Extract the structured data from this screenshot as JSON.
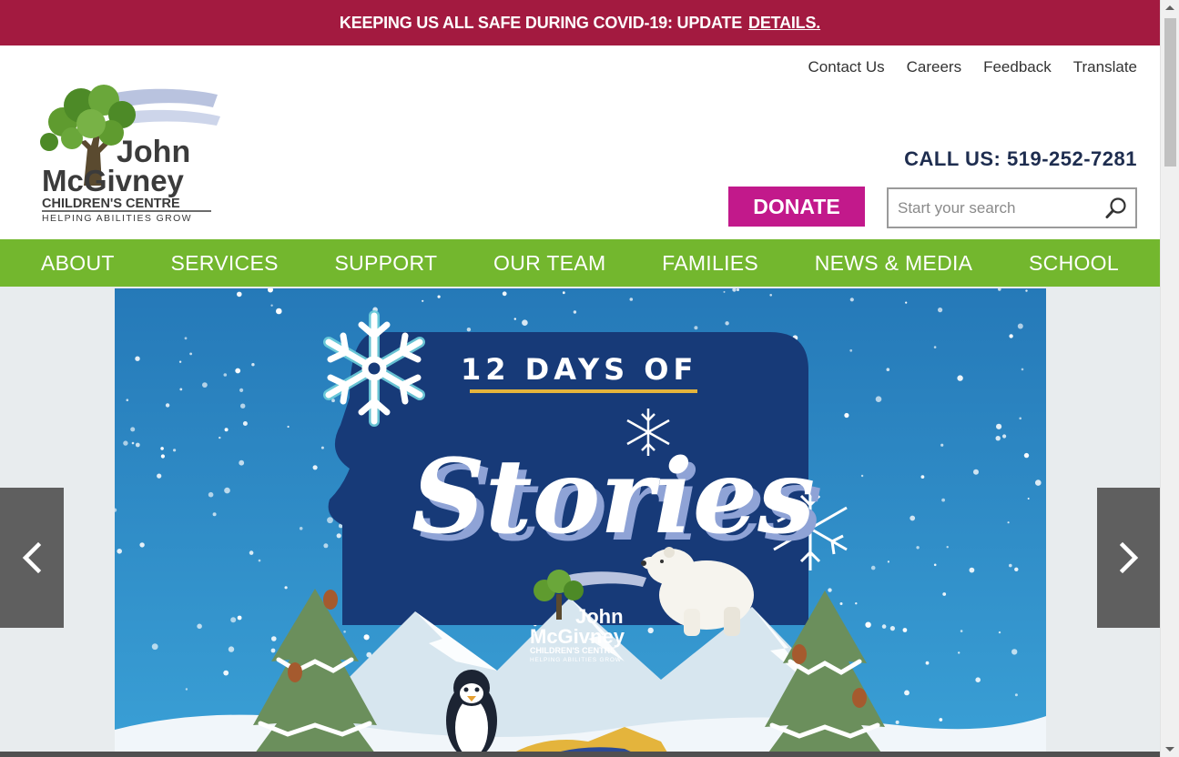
{
  "alert": {
    "text": "KEEPING US ALL SAFE DURING COVID-19: UPDATE",
    "link": "DETAILS."
  },
  "utility_nav": [
    "Contact Us",
    "Careers",
    "Feedback",
    "Translate"
  ],
  "logo": {
    "line1": "John",
    "line2": "McGivney",
    "line3": "CHILDREN'S CENTRE",
    "tagline": "HELPING ABILITIES GROW"
  },
  "call_us": "CALL US: 519-252-7281",
  "donate_label": "DONATE",
  "search": {
    "placeholder": "Start your search"
  },
  "main_nav": [
    "ABOUT",
    "SERVICES",
    "SUPPORT",
    "OUR TEAM",
    "FAMILIES",
    "NEWS & MEDIA",
    "SCHOOL"
  ],
  "banner": {
    "title_top": "12 DAYS OF",
    "title_main": "Stories",
    "logo_line1": "John",
    "logo_line2": "McGivney",
    "logo_line3": "CHILDREN'S CENTRE",
    "logo_tagline": "HELPING ABILITIES GROW"
  },
  "colors": {
    "alert_bg": "#a31a40",
    "nav_green": "#73b72e",
    "donate_magenta": "#c2198b",
    "navy": "#1e2d4f",
    "banner_sky": "#2f8fc7",
    "banner_panel": "#173a78"
  },
  "icons": {
    "search": "magnifier-icon",
    "prev": "chevron-left-icon",
    "next": "chevron-right-icon"
  }
}
